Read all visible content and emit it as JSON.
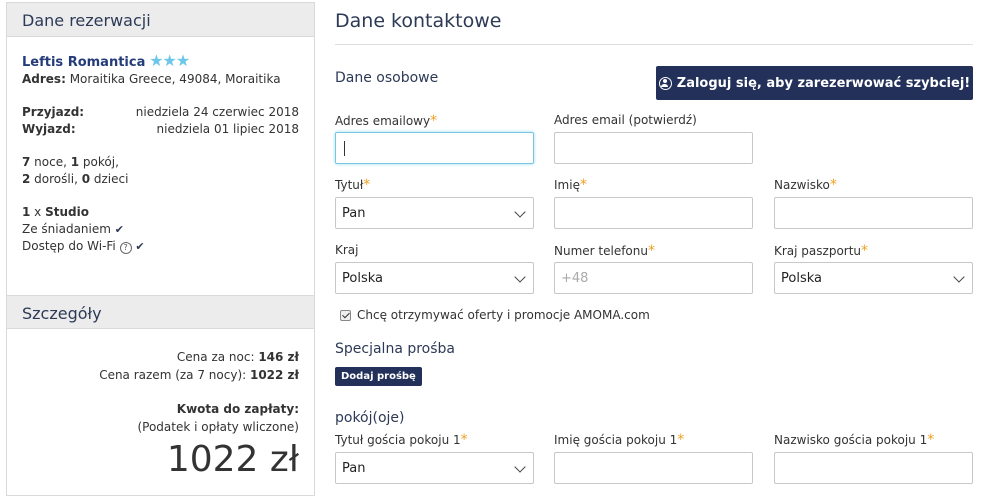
{
  "sidebar": {
    "reservation_title": "Dane rezerwacji",
    "hotel_name": "Leftis Romantica",
    "stars": "★★★",
    "address_label": "Adres:",
    "address_value": "Moraitika Greece, 49084, Moraitika",
    "checkin_label": "Przyjazd:",
    "checkin_value": "niedziela 24 czerwiec 2018",
    "checkout_label": "Wyjazd:",
    "checkout_value": "niedziela 01 lipiec 2018",
    "nights_count": "7",
    "nights_text": " noce, ",
    "rooms_count": "1",
    "rooms_text": " pokój,",
    "adults_count": "2",
    "adults_text": " dorośli, ",
    "children_count": "0",
    "children_text": " dzieci",
    "room_qty": "1",
    "room_x": " x ",
    "room_type": "Studio",
    "amenity_breakfast": "Ze śniadaniem",
    "amenity_wifi": "Dostęp do Wi-Fi",
    "details_title": "Szczegóły",
    "price_per_night_label": "Cena za noc: ",
    "price_per_night_value": "146 zł",
    "price_total_label": "Cena razem (za 7 nocy): ",
    "price_total_value": "1022 zł",
    "amount_due_label": "Kwota do zapłaty:",
    "taxes_note": "(Podatek i opłaty wliczone)",
    "amount_due_value": "1022 zł"
  },
  "main": {
    "title": "Dane kontaktowe",
    "personal_title": "Dane osobowe",
    "login_button": "Zaloguj się, aby zarezerwować szybciej!",
    "email_label": "Adres emailowy",
    "email_confirm_label": "Adres email (potwierdź)",
    "title_label": "Tytuł",
    "title_value": "Pan",
    "first_name_label": "Imię",
    "last_name_label": "Nazwisko",
    "country_label": "Kraj",
    "country_value": "Polska",
    "phone_label": "Numer telefonu",
    "phone_placeholder": "+48",
    "passport_country_label": "Kraj paszportu",
    "passport_country_value": "Polska",
    "offers_checkbox_label": "Chcę otrzymywać oferty i promocje AMOMA.com",
    "special_request_title": "Specjalna prośba",
    "add_request_button": "Dodaj prośbę",
    "rooms_title": "pokój(oje)",
    "guest_title_label": "Tytuł gościa pokoju 1",
    "guest_title_value": "Pan",
    "guest_first_name_label": "Imię gościa pokoju 1",
    "guest_last_name_label": "Nazwisko gościa pokoju 1",
    "required_mark": "*"
  }
}
